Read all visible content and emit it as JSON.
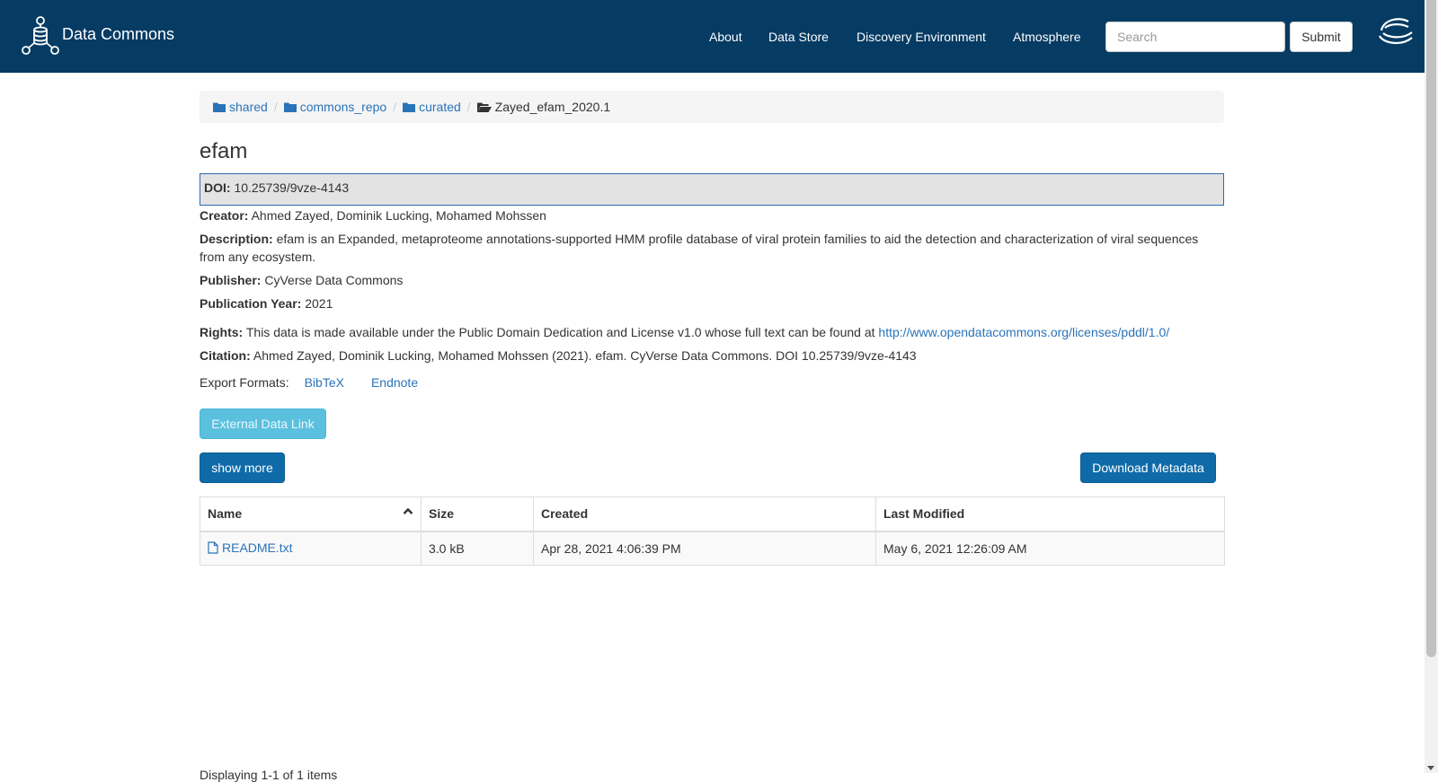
{
  "header": {
    "brand": "Data Commons",
    "nav": [
      "About",
      "Data Store",
      "Discovery Environment",
      "Atmosphere"
    ],
    "search_placeholder": "Search",
    "submit_label": "Submit"
  },
  "breadcrumb": [
    "shared",
    "commons_repo",
    "curated",
    "Zayed_efam_2020.1"
  ],
  "title": "efam",
  "metadata": {
    "doi_label": "DOI:",
    "doi": "10.25739/9vze-4143",
    "creator_label": "Creator:",
    "creator": "Ahmed Zayed, Dominik Lucking, Mohamed Mohssen",
    "description_label": "Description:",
    "description": "efam is an Expanded, metaproteome annotations-supported HMM profile database of viral protein families to aid the detection and characterization of viral sequences from any ecosystem.",
    "publisher_label": "Publisher:",
    "publisher": "CyVerse Data Commons",
    "year_label": "Publication Year:",
    "year": "2021",
    "rights_label": "Rights:",
    "rights": "This data is made available under the Public Domain Dedication and License v1.0 whose full text can be found at",
    "rights_url": "http://www.opendatacommons.org/licenses/pddl/1.0/",
    "citation_label": "Citation:",
    "citation": "Ahmed Zayed, Dominik Lucking, Mohamed Mohssen (2021). efam. CyVerse Data Commons. DOI 10.25739/9vze-4143"
  },
  "export": {
    "label": "Export Formats:",
    "formats": [
      "BibTeX",
      "Endnote"
    ]
  },
  "buttons": {
    "external": "External Data Link",
    "show_more": "show more",
    "download_metadata": "Download Metadata"
  },
  "table": {
    "columns": [
      "Name",
      "Size",
      "Created",
      "Last Modified"
    ],
    "rows": [
      {
        "name": "README.txt",
        "size": "3.0 kB",
        "created": "Apr 28, 2021 4:06:39 PM",
        "modified": "May 6, 2021 12:26:09 AM"
      }
    ]
  },
  "footer": "Displaying 1-1 of 1 items",
  "colors": {
    "header_bg": "#063b63",
    "link": "#2a73b9",
    "primary": "#0f6ba8",
    "info": "#5bc0de"
  }
}
